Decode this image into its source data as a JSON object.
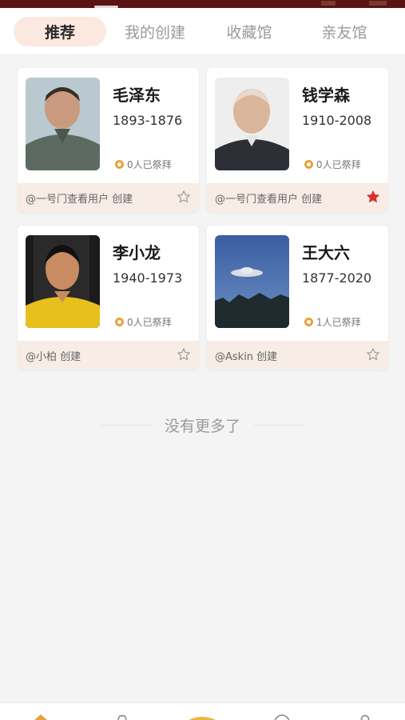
{
  "tabs": [
    {
      "label": "推荐",
      "active": true
    },
    {
      "label": "我的创建",
      "active": false
    },
    {
      "label": "收藏馆",
      "active": false
    },
    {
      "label": "亲友馆",
      "active": false
    }
  ],
  "cards": [
    {
      "name": "毛泽东",
      "years": "1893-1876",
      "worship": "0人已祭拜",
      "creator": "@一号门查看用户 创建",
      "favorited": false,
      "photo_icon": "portrait-photo"
    },
    {
      "name": "钱学森",
      "years": "1910-2008",
      "worship": "0人已祭拜",
      "creator": "@一号门查看用户 创建",
      "favorited": true,
      "photo_icon": "portrait-photo"
    },
    {
      "name": "李小龙",
      "years": "1940-1973",
      "worship": "0人已祭拜",
      "creator": "@小柏 创建",
      "favorited": false,
      "photo_icon": "portrait-photo"
    },
    {
      "name": "王大六",
      "years": "1877-2020",
      "worship": "1人已祭拜",
      "creator": "@Askin 创建",
      "favorited": false,
      "photo_icon": "ufo-photo"
    }
  ],
  "no_more": "没有更多了",
  "colors": {
    "accent_bg": "#fbe9e0",
    "footer_bg": "#f7ece6",
    "star_active": "#d9302c",
    "coin": "#e8a23a",
    "statusbar": "#5a1414"
  }
}
